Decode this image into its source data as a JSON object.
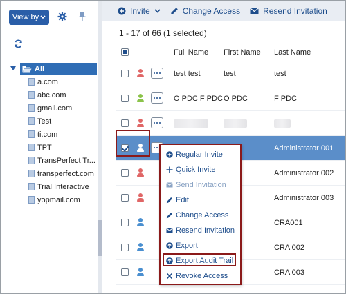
{
  "sidebar": {
    "view_by_label": "View by",
    "tree": {
      "root_label": "All",
      "items": [
        "a.com",
        "abc.com",
        "gmail.com",
        "Test",
        "ti.com",
        "TPT",
        "TransPerfect Tr...",
        "transperfect.com",
        "Trial Interactive",
        "yopmail.com"
      ]
    }
  },
  "toolbar": {
    "invite_label": "Invite",
    "change_access_label": "Change Access",
    "resend_invitation_label": "Resend Invitation"
  },
  "grid": {
    "record_count": "1 - 17 of 66 (1 selected)",
    "columns": [
      "Full Name",
      "First Name",
      "Last Name"
    ],
    "rows": [
      {
        "full_name": "test test",
        "first_name": "test",
        "last_name": "test",
        "status_color": "#e06666",
        "checked": false,
        "blurred": false
      },
      {
        "full_name": "O PDC F PDC",
        "first_name": "O PDC",
        "last_name": "F PDC",
        "status_color": "#8bc34a",
        "checked": false,
        "blurred": false
      },
      {
        "full_name": "",
        "first_name": "",
        "last_name": "",
        "status_color": "#e06666",
        "checked": false,
        "blurred": true
      },
      {
        "full_name": "",
        "first_name": "",
        "last_name": "Administrator 001",
        "status_color": "#ffffff",
        "checked": true,
        "blurred": false
      },
      {
        "full_name": "",
        "first_name": "",
        "last_name": "Administrator 002",
        "status_color": "#e06666",
        "checked": false,
        "blurred": false
      },
      {
        "full_name": "",
        "first_name": "",
        "last_name": "Administrator 003",
        "status_color": "#e06666",
        "checked": false,
        "blurred": false
      },
      {
        "full_name": "",
        "first_name": "",
        "last_name": "CRA001",
        "status_color": "#4a8fd0",
        "checked": false,
        "blurred": false
      },
      {
        "full_name": "",
        "first_name": "",
        "last_name": "CRA 002",
        "status_color": "#4a8fd0",
        "checked": false,
        "blurred": false
      },
      {
        "full_name": "",
        "first_name": "",
        "last_name": "CRA 003",
        "status_color": "#4a8fd0",
        "checked": false,
        "blurred": false
      }
    ]
  },
  "context_menu": {
    "items": [
      {
        "label": "Regular Invite",
        "icon": "plus-circle-icon",
        "disabled": false
      },
      {
        "label": "Quick Invite",
        "icon": "plus-icon",
        "disabled": false
      },
      {
        "label": "Send Invitation",
        "icon": "envelope-icon",
        "disabled": true
      },
      {
        "label": "Edit",
        "icon": "pencil-icon",
        "disabled": false
      },
      {
        "label": "Change Access",
        "icon": "pencil-icon",
        "disabled": false
      },
      {
        "label": "Resend Invitation",
        "icon": "envelope-icon",
        "disabled": false
      },
      {
        "label": "Export",
        "icon": "arrow-up-circle-icon",
        "disabled": false
      },
      {
        "label": "Export Audit Trail",
        "icon": "arrow-up-circle-icon",
        "disabled": false
      },
      {
        "label": "Revoke Access",
        "icon": "close-icon",
        "disabled": false
      }
    ]
  },
  "colors": {
    "brand_blue": "#2a5ea8",
    "selected_row": "#5b8ec9",
    "annotation_red": "#8b1a1a"
  }
}
